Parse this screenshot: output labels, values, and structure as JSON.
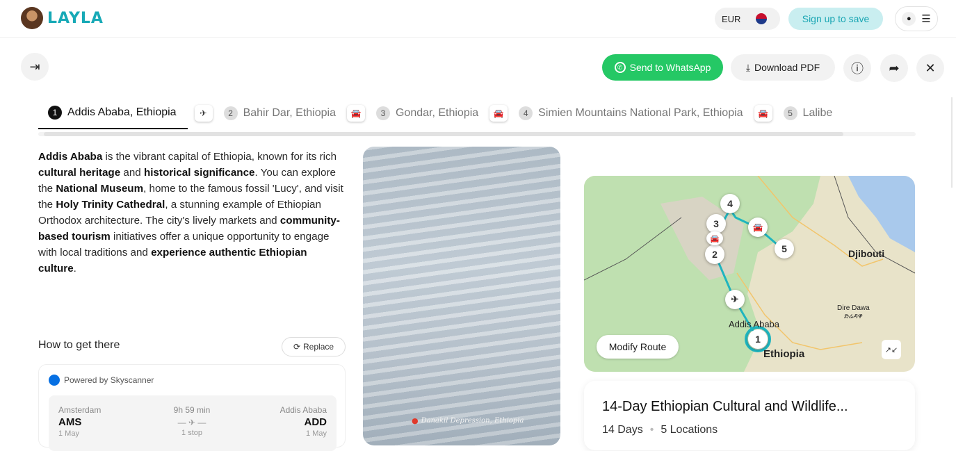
{
  "header": {
    "brand": "LAYLA",
    "currency": "EUR",
    "signup_label": "Sign up to save",
    "menu_icon": "hamburger-icon",
    "user_icon": "user-icon"
  },
  "toolbar": {
    "whatsapp_label": "Send to WhatsApp",
    "pdf_label": "Download PDF"
  },
  "stops": [
    {
      "num": "1",
      "name": "Addis Ababa, Ethiopia"
    },
    {
      "num": "2",
      "name": "Bahir Dar, Ethiopia"
    },
    {
      "num": "3",
      "name": "Gondar, Ethiopia"
    },
    {
      "num": "4",
      "name": "Simien Mountains National Park, Ethiopia"
    },
    {
      "num": "5",
      "name": "Lalibe"
    }
  ],
  "transport": [
    "✈",
    "🚘",
    "🚘",
    "🚘"
  ],
  "description": {
    "p1": "Addis Ababa",
    "p2": " is the vibrant capital of Ethiopia, known for its rich ",
    "p3": "cultural heritage",
    "p4": " and ",
    "p5": "historical significance",
    "p6": ". You can explore the ",
    "p7": "National Museum",
    "p8": ", home to the famous fossil 'Lucy', and visit the ",
    "p9": "Holy Trinity Cathedral",
    "p10": ", a stunning example of Ethiopian Orthodox architecture. The city's lively markets and ",
    "p11": "community-based tourism",
    "p12": " initiatives offer a unique opportunity to engage with local traditions and ",
    "p13": "experience authentic Ethiopian culture",
    "p14": "."
  },
  "how_to": {
    "title": "How to get there",
    "replace_label": "Replace",
    "powered": "Powered by Skyscanner",
    "from_city": "Amsterdam",
    "from_code": "AMS",
    "from_date": "1 May",
    "duration": "9h 59 min",
    "stops": "1 stop",
    "to_city": "Addis Ababa",
    "to_code": "ADD",
    "to_date": "1 May"
  },
  "photo": {
    "caption": "Danakil Depression, Ethiopia"
  },
  "map": {
    "modify_label": "Modify Route",
    "label_djibouti": "Djibouti",
    "label_dire_dawa": "Dire Dawa",
    "label_dire_dawa_am": "ድሬዳዋ",
    "label_addis": "Addis Ababa",
    "label_ethiopia": "Ethiopia",
    "markers": [
      "1",
      "2",
      "3",
      "4",
      "5"
    ]
  },
  "trip": {
    "title": "14-Day Ethiopian Cultural and Wildlife...",
    "days": "14 Days",
    "locations": "5 Locations"
  },
  "colors": {
    "brand": "#17a9b6",
    "whatsapp": "#25c865",
    "route": "#1fb5bf"
  }
}
